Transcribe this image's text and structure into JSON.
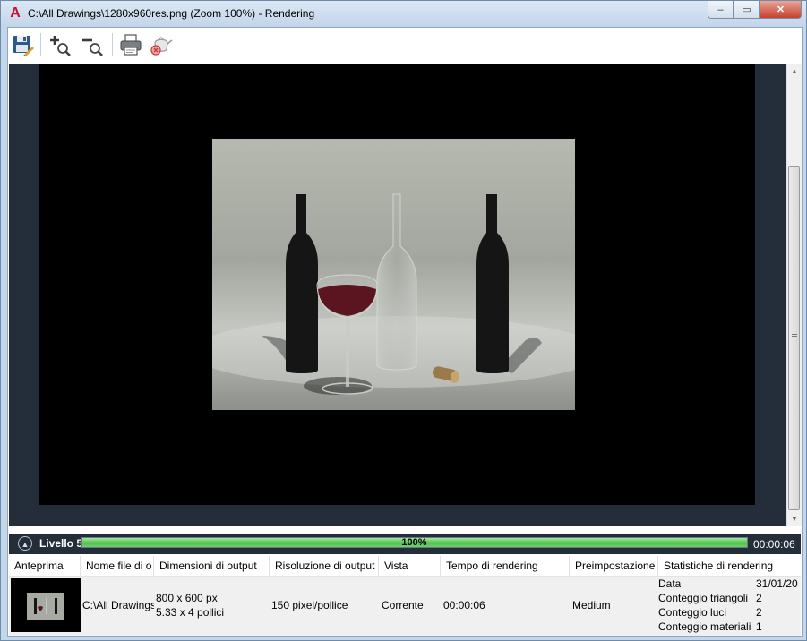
{
  "window": {
    "title": "C:\\All Drawings\\1280x960res.png (Zoom 100%) - Rendering",
    "app_icon": "A",
    "minimize_glyph": "–",
    "maximize_glyph": "▭",
    "close_glyph": "✕"
  },
  "toolbar": {
    "items": [
      "save-icon",
      "zoom-in-icon",
      "zoom-out-icon",
      "print-icon",
      "cancel-render-icon"
    ]
  },
  "progress": {
    "collapse_glyph": "▲",
    "level_label": "Livello 5",
    "percent_text": "100%",
    "percent_value": 100,
    "elapsed": "00:00:06"
  },
  "history": {
    "columns": [
      "Anteprima",
      "Nome file di o",
      "Dimensioni di output",
      "Risoluzione di output",
      "Vista",
      "Tempo di rendering",
      "Preimpostazione",
      "Statistiche di rendering"
    ],
    "row": {
      "file_name": "C:\\All Drawings",
      "dim_px": "800 x 600 px",
      "dim_in": "5.33 x 4 pollici",
      "resolution": "150 pixel/pollice",
      "view": "Corrente",
      "render_time": "00:00:06",
      "preset": "Medium",
      "stats": [
        {
          "label": "Data",
          "value": "31/01/20"
        },
        {
          "label": "Conteggio triangoli",
          "value": "2"
        },
        {
          "label": "Conteggio luci",
          "value": "2"
        },
        {
          "label": "Conteggio materiali",
          "value": "1"
        }
      ]
    }
  },
  "colors": {
    "viewport_bg": "#232e3a",
    "progress_fill": "#4fc24b",
    "titlebar": "#c3d5ea"
  }
}
